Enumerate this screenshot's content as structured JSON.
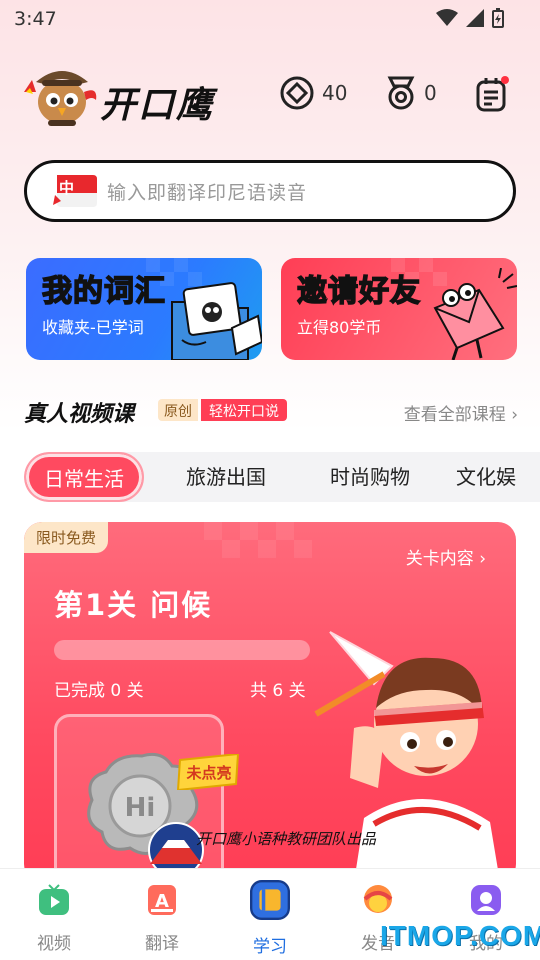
{
  "status_bar": {
    "time": "3:47"
  },
  "header": {
    "app_title": "开口鹰",
    "coins": "40",
    "medals": "0"
  },
  "search": {
    "flag_label": "中",
    "placeholder": "输入即翻译印尼语读音"
  },
  "feature_cards": [
    {
      "title": "我的词汇",
      "subtitle": "收藏夹-已学词"
    },
    {
      "title": "邀请好友",
      "subtitle": "立得80学币"
    }
  ],
  "section": {
    "title": "真人视频课",
    "tag_original": "原创",
    "tag_easy": "轻松开口说",
    "see_all": "查看全部课程"
  },
  "tabs": [
    {
      "label": "日常生活",
      "active": true
    },
    {
      "label": "旅游出国",
      "active": false
    },
    {
      "label": "时尚购物",
      "active": false
    },
    {
      "label": "文化娱",
      "active": false
    }
  ],
  "lesson": {
    "free_badge": "限时免费",
    "level_link": "关卡内容",
    "title": "第1关 问候",
    "progress": 0,
    "done": "已完成 0 关",
    "total": "共 6 关",
    "unlit": "未点亮",
    "hi": "Hi",
    "credit": "开口鹰小语种教研团队出品"
  },
  "bottom_nav": [
    {
      "label": "视频",
      "active": false
    },
    {
      "label": "翻译",
      "active": false
    },
    {
      "label": "学习",
      "active": true
    },
    {
      "label": "发音",
      "active": false
    },
    {
      "label": "我的",
      "active": false
    }
  ],
  "watermark": "ITMOP.COM",
  "colors": {
    "accent": "#ff4a60",
    "brand_blue": "#2b7bff",
    "nav_active": "#1f6ee0"
  }
}
